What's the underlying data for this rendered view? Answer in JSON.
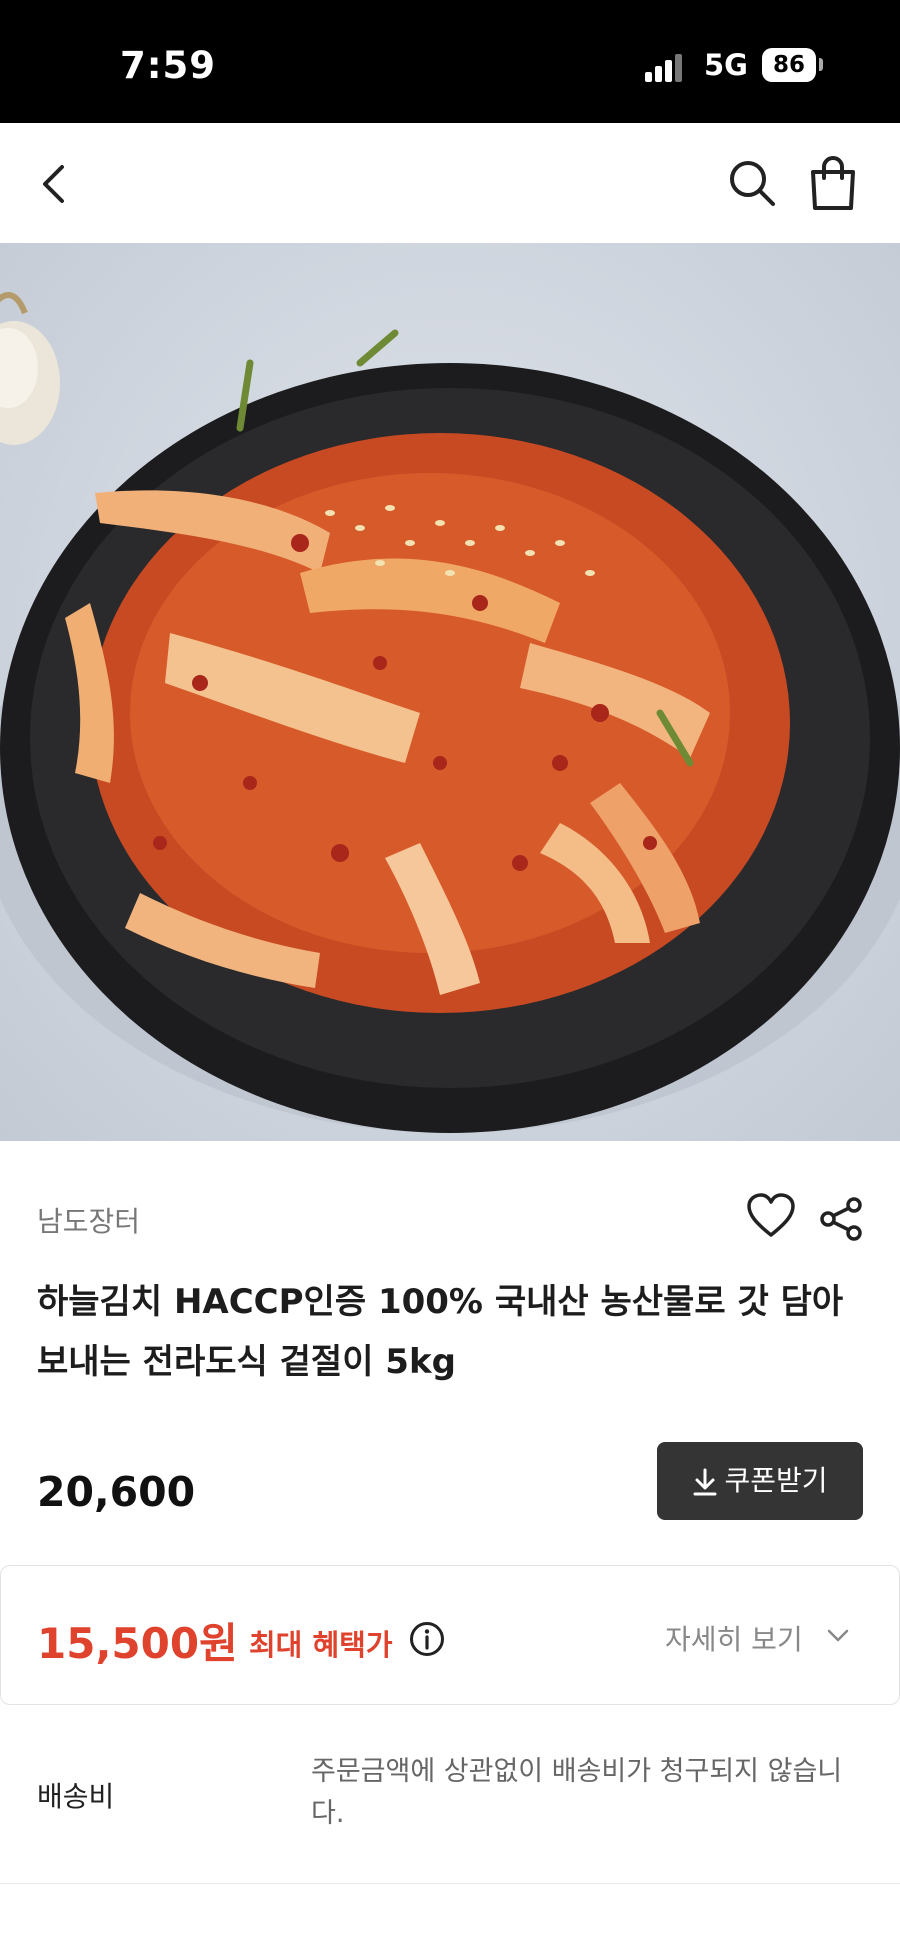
{
  "status_bar": {
    "time": "7:59",
    "network": "5G",
    "battery": "86"
  },
  "nav": {
    "back_icon": "chevron-left-icon",
    "search_icon": "search-icon",
    "cart_icon": "shopping-bag-icon"
  },
  "product": {
    "seller": "남도장터",
    "title": "하늘김치 HACCP인증 100% 국내산 농산물로 갓 담아 보내는 전라도식 겉절이 5kg",
    "original_price": "20,600",
    "coupon_label": "쿠폰받기"
  },
  "benefit": {
    "price": "15,500원",
    "label": "최대 혜택가",
    "detail_label": "자세히 보기"
  },
  "shipping": {
    "label": "배송비",
    "text": "주문금액에 상관없이 배송비가 청구되지 않습니다."
  },
  "colors": {
    "accent": "#e0432d",
    "dark_button": "#343434",
    "status_bar": "#000000"
  }
}
